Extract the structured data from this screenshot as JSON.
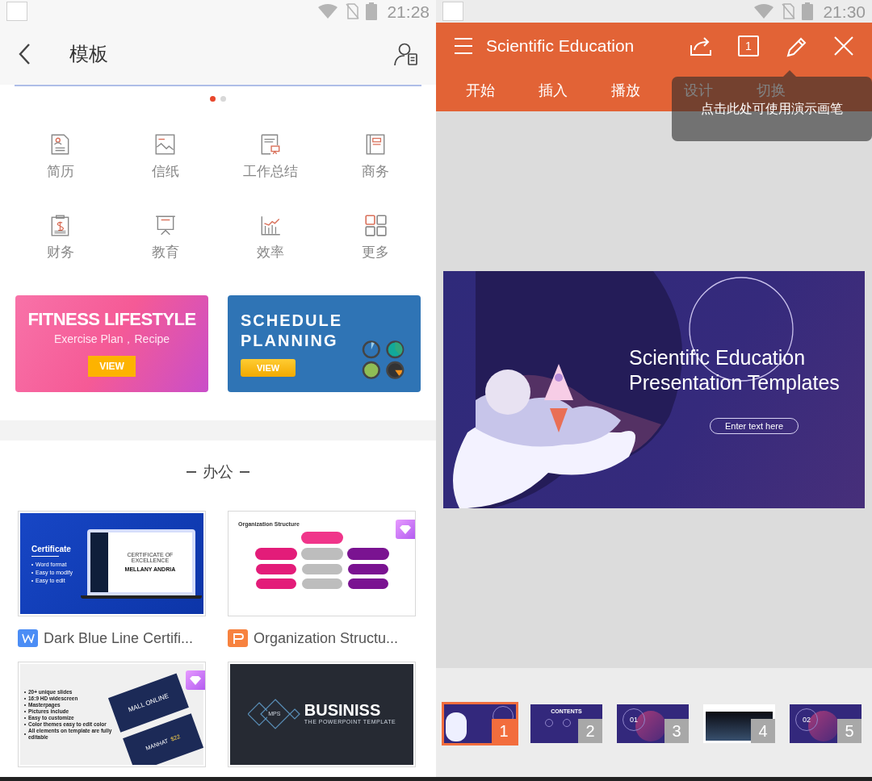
{
  "left_screen": {
    "status_bar": {
      "time": "21:28"
    },
    "header": {
      "title": "模板"
    },
    "pager": [
      {
        "selected": true
      },
      {
        "selected": false
      }
    ],
    "categories": [
      {
        "label": "简历"
      },
      {
        "label": "信纸"
      },
      {
        "label": "工作总结"
      },
      {
        "label": "商务"
      },
      {
        "label": "财务"
      },
      {
        "label": "教育"
      },
      {
        "label": "效率"
      },
      {
        "label": "更多"
      }
    ],
    "banners": [
      {
        "kind": "fitness",
        "title": "FITNESS LIFESTYLE",
        "subtitle": "Exercise Plan，Recipe",
        "button": "VIEW"
      },
      {
        "kind": "schedule",
        "title": "SCHEDULE PLANNING",
        "button": "VIEW"
      }
    ],
    "section_title": "办公",
    "templates": [
      {
        "kind": "certificate",
        "premium": false,
        "app": {
          "kind": "writer"
        },
        "name": "Dark Blue Line Certifi...",
        "texts": [
          "Certificate",
          "Word format",
          "Easy to modify",
          "Easy to edit",
          "CERTIFICATE OF EXCELLENCE",
          "MELLANY ANDRIA"
        ]
      },
      {
        "kind": "org",
        "premium": true,
        "app": {
          "kind": "presentation"
        },
        "name": "Organization Structu...",
        "texts": [
          "Organization Structure"
        ]
      },
      {
        "kind": "mall",
        "premium": true,
        "texts": [
          "20+ unique slides",
          "16:9 HD widescreen",
          "Masterpages",
          "Pictures include",
          "Easy to customize",
          "Color themes easy to edit color",
          "All elements on template are fully editable",
          "MALL ONLINE",
          "MANHAT",
          "$22"
        ]
      },
      {
        "kind": "business",
        "premium": false,
        "texts": [
          "MPS",
          "BUSINISS",
          "THE POWERPOINT TEMPLATE"
        ]
      }
    ]
  },
  "right_screen": {
    "status_bar": {
      "time": "21:30"
    },
    "toolbar": {
      "title": "Scientific Education",
      "page_button": "1"
    },
    "tabs": [
      {
        "label": "开始"
      },
      {
        "label": "插入"
      },
      {
        "label": "播放"
      },
      {
        "label": "设计"
      },
      {
        "label": "切换"
      }
    ],
    "tooltip": "点击此处可使用演示画笔",
    "slide": {
      "title": "Scientific Education Presentation Templates",
      "button": "Enter text here"
    },
    "thumbnails": [
      {
        "kind": "title",
        "number": "1",
        "selected": true
      },
      {
        "kind": "contents",
        "number": "2",
        "selected": false,
        "text": "CONTENTS"
      },
      {
        "kind": "section",
        "number": "3",
        "selected": false,
        "text": "01"
      },
      {
        "kind": "photo",
        "number": "4",
        "selected": false
      },
      {
        "kind": "section",
        "number": "5",
        "selected": false,
        "text": "02"
      }
    ]
  }
}
